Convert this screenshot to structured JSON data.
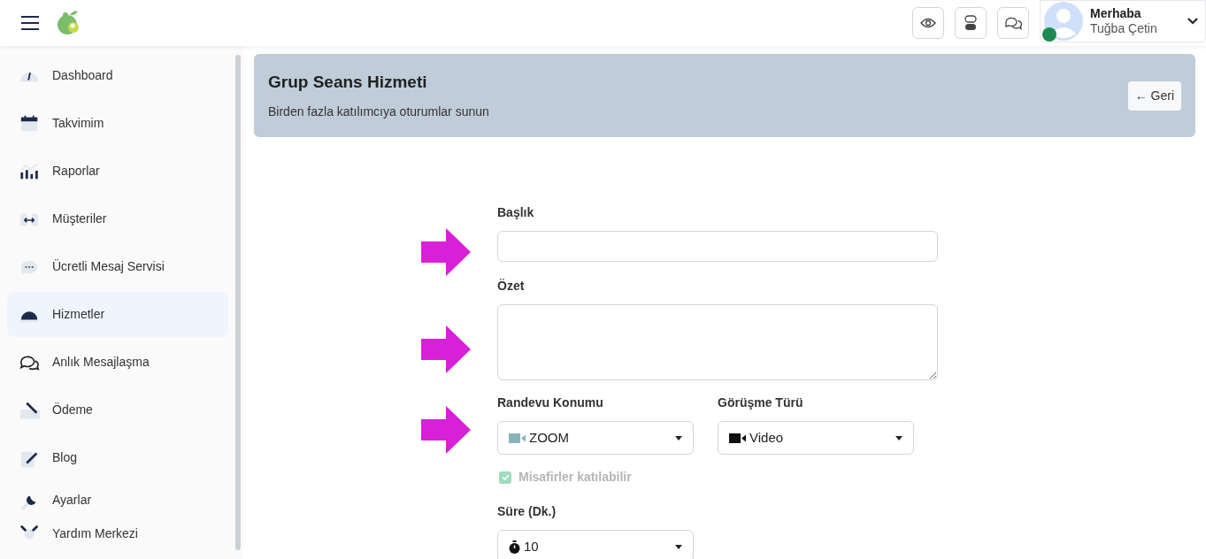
{
  "header": {
    "greeting": "Merhaba",
    "user_name": "Tuğba Çetin",
    "online": true
  },
  "sidebar": {
    "items": [
      {
        "label": "Dashboard",
        "selected": false
      },
      {
        "label": "Takvimim",
        "selected": false
      },
      {
        "label": "Raporlar",
        "selected": false
      },
      {
        "label": "Müşteriler",
        "selected": false
      },
      {
        "label": "Ücretli Mesaj Servisi",
        "selected": false
      },
      {
        "label": "Hizmetler",
        "selected": true
      },
      {
        "label": "Anlık Mesajlaşma",
        "selected": false
      },
      {
        "label": "Ödeme",
        "selected": false
      },
      {
        "label": "Blog",
        "selected": false
      },
      {
        "label": "Ayarlar",
        "selected": false
      },
      {
        "label": "Yardım Merkezi",
        "selected": false
      }
    ]
  },
  "banner": {
    "title": "Grup Seans Hizmeti",
    "subtitle": "Birden fazla katılımcıya oturumlar sunun",
    "back_button": "← Geri"
  },
  "form": {
    "title_label": "Başlık",
    "summary_label": "Özet",
    "location_label": "Randevu Konumu",
    "location_value": "ZOOM",
    "meeting_type_label": "Görüşme Türü",
    "meeting_type_value": "Video",
    "guests": {
      "label": "Misafirler katılabilir",
      "checked": true,
      "disabled": true
    },
    "duration_label": "Süre (Dk.)",
    "duration_value": "10"
  }
}
